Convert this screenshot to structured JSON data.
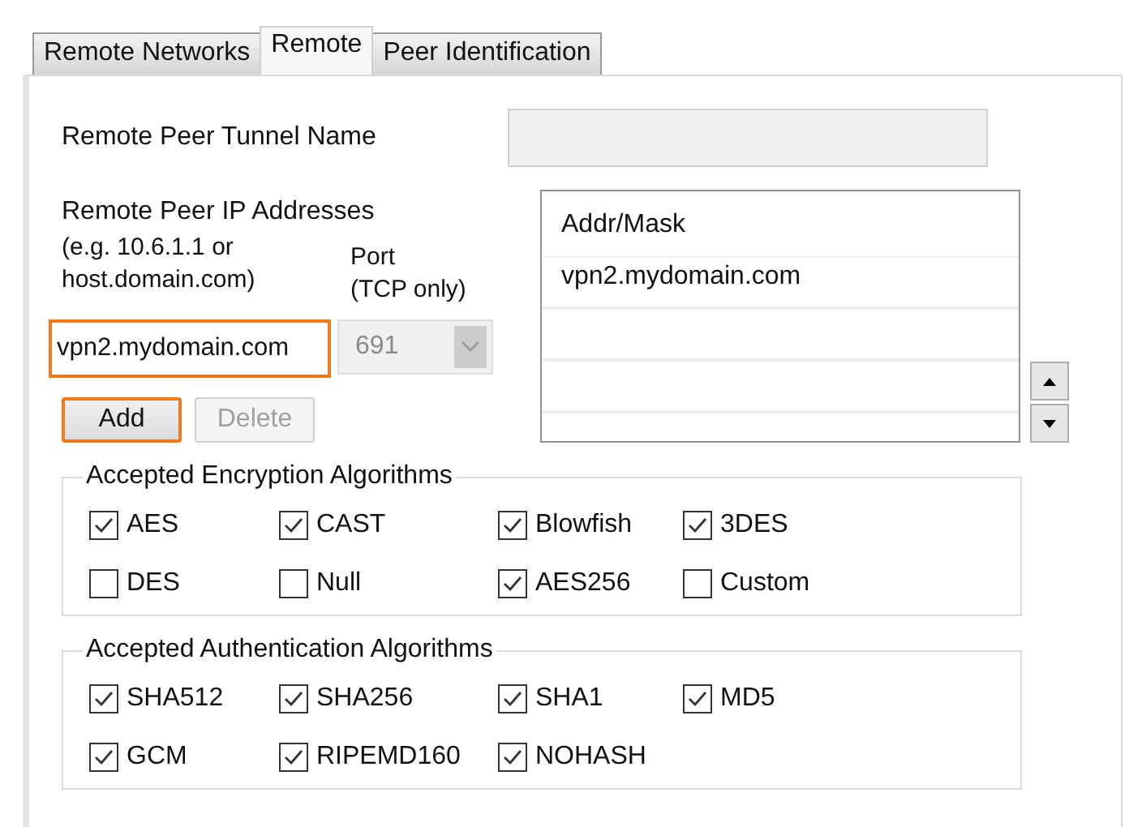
{
  "tabs": [
    {
      "label": "Remote Networks",
      "selected": false
    },
    {
      "label": "Remote",
      "selected": true
    },
    {
      "label": "Peer Identification",
      "selected": false
    }
  ],
  "tunnel_name": {
    "label": "Remote Peer Tunnel Name",
    "disabled": true
  },
  "peer_addresses": {
    "label": "Remote Peer IP Addresses",
    "hint": "(e.g. 10.6.1.1 or\nhost.domain.com)"
  },
  "address_input": {
    "value": "vpn2.mydomain.com",
    "highlighted": true
  },
  "port": {
    "label": "Port\n(TCP only)",
    "value": "691",
    "disabled": true
  },
  "address_list": {
    "column": "Addr/Mask",
    "rows": [
      "vpn2.mydomain.com"
    ]
  },
  "buttons": [
    {
      "label": "Add",
      "disabled": false,
      "highlighted": true
    },
    {
      "label": "Delete",
      "disabled": true,
      "highlighted": false
    }
  ],
  "encryption": {
    "title": "Accepted Encryption Algorithms",
    "options": [
      {
        "label": "AES",
        "checked": true
      },
      {
        "label": "CAST",
        "checked": true
      },
      {
        "label": "Blowfish",
        "checked": true
      },
      {
        "label": "3DES",
        "checked": true
      },
      {
        "label": "DES",
        "checked": false
      },
      {
        "label": "Null",
        "checked": false
      },
      {
        "label": "AES256",
        "checked": true
      },
      {
        "label": "Custom",
        "checked": false
      }
    ]
  },
  "authentication": {
    "title": "Accepted Authentication Algorithms",
    "options": [
      {
        "label": "SHA512",
        "checked": true
      },
      {
        "label": "SHA256",
        "checked": true
      },
      {
        "label": "SHA1",
        "checked": true
      },
      {
        "label": "MD5",
        "checked": true
      },
      {
        "label": "GCM",
        "checked": true
      },
      {
        "label": "RIPEMD160",
        "checked": true
      },
      {
        "label": "NOHASH",
        "checked": true
      }
    ]
  }
}
